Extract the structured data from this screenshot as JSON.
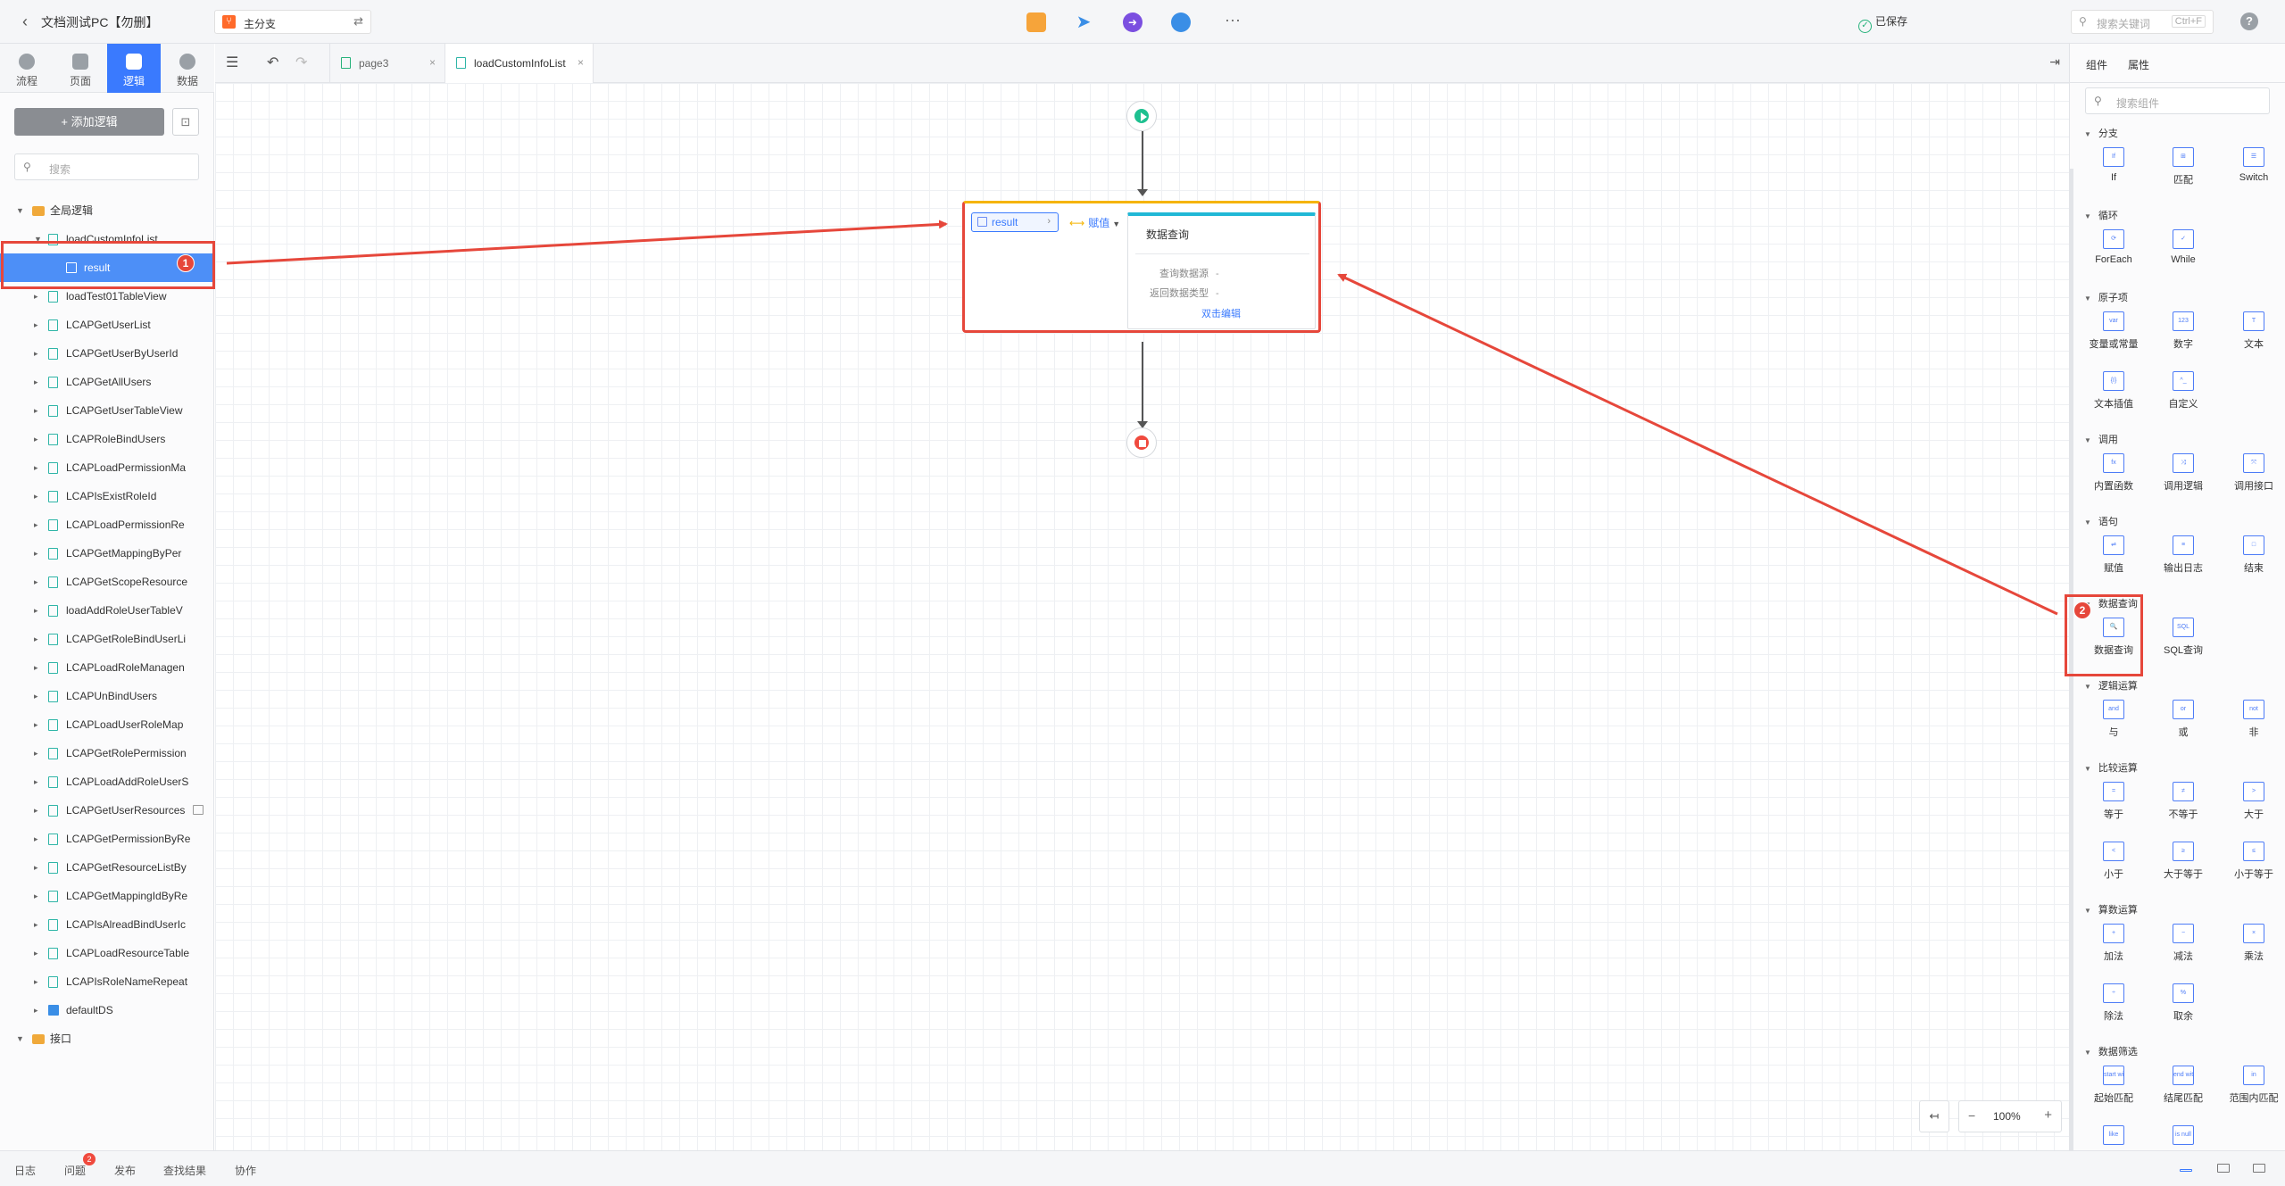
{
  "topbar": {
    "back_icon": "chevron-left-icon",
    "project_title": "文档测试PC【勿删】",
    "branch_label": "主分支",
    "branch_switch_icon": "swap-icon",
    "saved_label": "已保存",
    "search_placeholder": "搜索关键词",
    "search_shortcut": "Ctrl+F",
    "help_label": "?"
  },
  "left_tabs": [
    {
      "label": "流程",
      "icon": "flow-icon"
    },
    {
      "label": "页面",
      "icon": "page-icon"
    },
    {
      "label": "逻辑",
      "icon": "logic-icon",
      "active": true
    },
    {
      "label": "数据",
      "icon": "data-pie-icon"
    }
  ],
  "left_panel": {
    "add_button": "+ 添加逻辑",
    "search_placeholder": "搜索",
    "folders": {
      "global": "全局逻辑",
      "interface": "接口"
    },
    "logic_items": [
      "loadCustomInfoList",
      "result",
      "loadTest01TableView",
      "LCAPGetUserList",
      "LCAPGetUserByUserId",
      "LCAPGetAllUsers",
      "LCAPGetUserTableView",
      "LCAPRoleBindUsers",
      "LCAPLoadPermissionMa",
      "LCAPIsExistRoleId",
      "LCAPLoadPermissionRe",
      "LCAPGetMappingByPer",
      "LCAPGetScopeResource",
      "loadAddRoleUserTableV",
      "LCAPGetRoleBindUserLi",
      "LCAPLoadRoleManagen",
      "LCAPUnBindUsers",
      "LCAPLoadUserRoleMap",
      "LCAPGetRolePermission",
      "LCAPLoadAddRoleUserS",
      "LCAPGetUserResources",
      "LCAPGetPermissionByRe",
      "LCAPGetResourceListBy",
      "LCAPGetMappingIdByRe",
      "LCAPIsAlreadBindUserIc",
      "LCAPLoadResourceTable",
      "LCAPIsRoleNameRepeat",
      "defaultDS"
    ]
  },
  "editor_tabs": [
    {
      "label": "page3",
      "close": "×"
    },
    {
      "label": "loadCustomInfoList",
      "close": "×",
      "active": true
    }
  ],
  "canvas": {
    "result_label": "result",
    "assign_label": "赋值",
    "query_title": "数据查询",
    "query_source_key": "查询数据源",
    "query_source_val": "-",
    "return_type_key": "返回数据类型",
    "return_type_val": "-",
    "edit_link": "双击编辑",
    "zoom": "100%"
  },
  "right_panel": {
    "tabs": [
      "组件",
      "属性"
    ],
    "search_placeholder": "搜索组件",
    "categories": [
      {
        "name": "分支",
        "items": [
          {
            "label": "If",
            "icon": "If"
          },
          {
            "label": "匹配",
            "icon": "⊞"
          },
          {
            "label": "Switch",
            "icon": "☰"
          }
        ]
      },
      {
        "name": "循环",
        "items": [
          {
            "label": "ForEach",
            "icon": "⟳"
          },
          {
            "label": "While",
            "icon": "✓"
          }
        ]
      },
      {
        "name": "原子项",
        "items": [
          {
            "label": "变量或常量",
            "icon": "var"
          },
          {
            "label": "数字",
            "icon": "123"
          },
          {
            "label": "文本",
            "icon": "T"
          },
          {
            "label": "文本插值",
            "icon": "{I}"
          },
          {
            "label": "自定义",
            "icon": "^_"
          }
        ]
      },
      {
        "name": "调用",
        "items": [
          {
            "label": "内置函数",
            "icon": "fx"
          },
          {
            "label": "调用逻辑",
            "icon": "⤨"
          },
          {
            "label": "调用接口",
            "icon": "⤧"
          }
        ]
      },
      {
        "name": "语句",
        "items": [
          {
            "label": "赋值",
            "icon": "⇌"
          },
          {
            "label": "输出日志",
            "icon": "≡"
          },
          {
            "label": "结束",
            "icon": "□"
          }
        ]
      },
      {
        "name": "数据查询",
        "items": [
          {
            "label": "数据查询",
            "icon": "🔍"
          },
          {
            "label": "SQL查询",
            "icon": "SQL"
          }
        ]
      },
      {
        "name": "逻辑运算",
        "items": [
          {
            "label": "与",
            "icon": "and"
          },
          {
            "label": "或",
            "icon": "or"
          },
          {
            "label": "非",
            "icon": "not"
          }
        ]
      },
      {
        "name": "比较运算",
        "items": [
          {
            "label": "等于",
            "icon": "="
          },
          {
            "label": "不等于",
            "icon": "≠"
          },
          {
            "label": "大于",
            "icon": ">"
          },
          {
            "label": "小于",
            "icon": "<"
          },
          {
            "label": "大于等于",
            "icon": "≥"
          },
          {
            "label": "小于等于",
            "icon": "≤"
          }
        ]
      },
      {
        "name": "算数运算",
        "items": [
          {
            "label": "加法",
            "icon": "+"
          },
          {
            "label": "减法",
            "icon": "−"
          },
          {
            "label": "乘法",
            "icon": "×"
          },
          {
            "label": "除法",
            "icon": "÷"
          },
          {
            "label": "取余",
            "icon": "%"
          }
        ]
      },
      {
        "name": "数据筛选",
        "items": [
          {
            "label": "起始匹配",
            "icon": "start with"
          },
          {
            "label": "结尾匹配",
            "icon": "end with"
          },
          {
            "label": "范围内匹配",
            "icon": "in"
          },
          {
            "label": "",
            "icon": "like"
          },
          {
            "label": "",
            "icon": "is null"
          }
        ]
      }
    ]
  },
  "bottombar": {
    "tabs": [
      "日志",
      "问题",
      "发布",
      "查找结果",
      "协作"
    ],
    "issue_count": "2"
  },
  "annotations": [
    "1",
    "2"
  ],
  "colors": {
    "accent": "#3a7afe",
    "annotation": "#e6473b",
    "start_node": "#1ec090",
    "end_node": "#f04a3e",
    "assign_border_top": "#f5b400"
  }
}
